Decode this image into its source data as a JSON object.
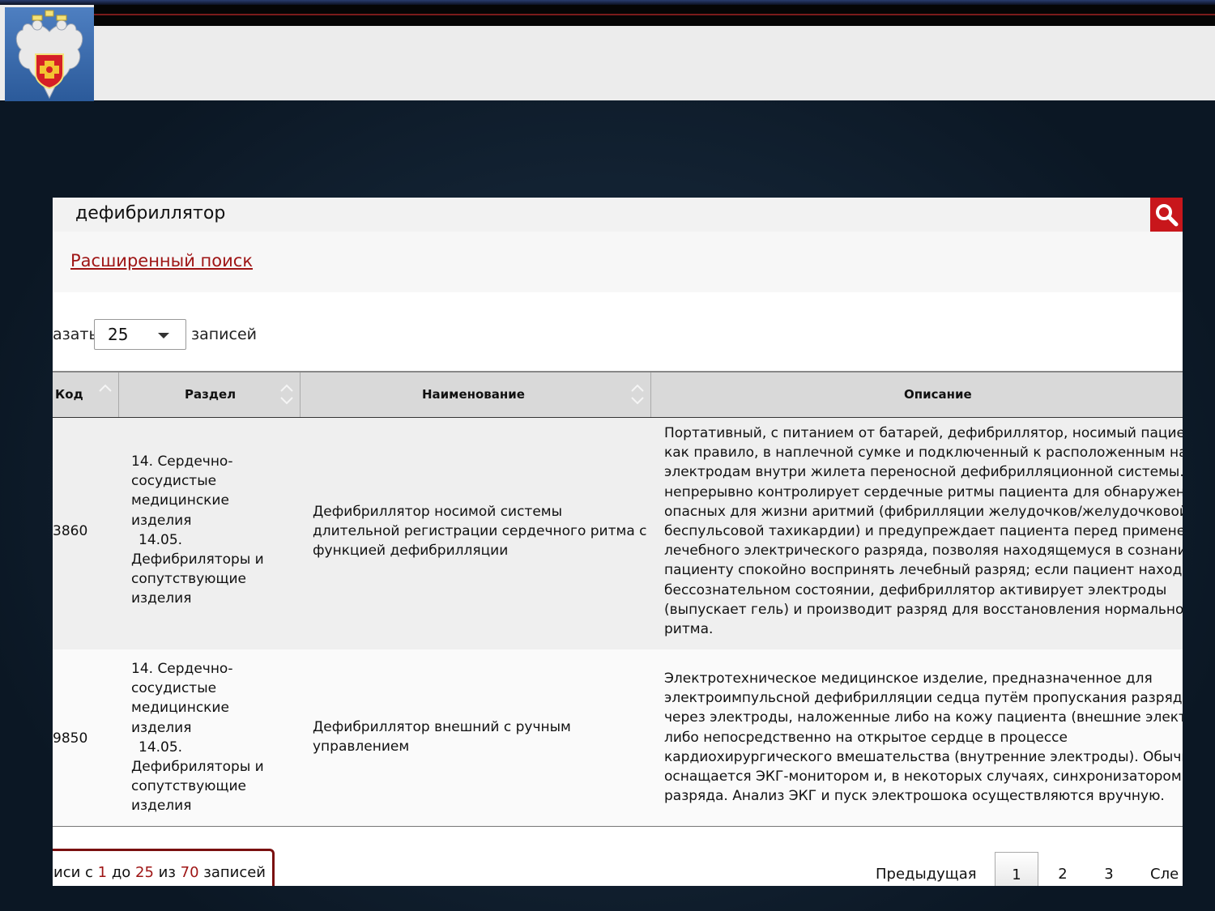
{
  "search": {
    "query": "дефибриллятор",
    "advanced_link": "Расширенный поиск"
  },
  "length": {
    "prefix": "азать",
    "value": "25",
    "suffix": "записей"
  },
  "table": {
    "headers": [
      "Код",
      "Раздел",
      "Наименование",
      "Описание"
    ],
    "rows": [
      {
        "code": "3860",
        "section": [
          "14. Сердечно-",
          "сосудистые",
          "медицинские",
          "изделия",
          "  14.05.",
          "Дефибриляторы и",
          "сопутствующие",
          "изделия"
        ],
        "name": [
          "Дефибриллятор носимой системы",
          "длительной регистрации сердечного ритма с",
          "функцией дефибрилляции"
        ],
        "description": [
          "Портативный, с питанием от батарей, дефибриллятор, носимый пациентом,",
          "как правило, в наплечной сумке и подключенный к расположенным на т",
          "электродам внутри жилета переносной дефибрилляционной системы. О",
          "непрерывно контролирует сердечные ритмы пациента для обнаружения",
          "опасных для жизни аритмий (фибрилляции желудочков/желудочковой",
          "беспульсовой тахикардии) и предупреждает пациента перед применени",
          "лечебного электрического разряда, позволяя находящемуся в сознании",
          "пациенту спокойно воспринять лечебный разряд; если пациент находит",
          "бессознательном состоянии, дефибриллятор активирует электроды",
          "(выпускает гель) и производит разряд для восстановления нормального",
          "ритма."
        ]
      },
      {
        "code": "9850",
        "section": [
          "14. Сердечно-",
          "сосудистые",
          "медицинские",
          "изделия",
          "  14.05.",
          "Дефибриляторы и",
          "сопутствующие",
          "изделия"
        ],
        "name": [
          "Дефибриллятор внешний с ручным",
          "управлением"
        ],
        "description": [
          "Электротехническое медицинское изделие, предназначенное для",
          "электроимпульсной дефибрилляции седца путём пропускания разряда",
          "через электроды, наложенные либо на кожу пациента (внешние электро",
          "либо непосредственно на открытое сердце в процессе",
          "кардиохирургического вмешательства (внутренние электроды). Обычно",
          "оснащается ЭКГ-монитором и, в некоторых случаях, синхронизатором",
          "разряда. Анализ ЭКГ и пуск электрошока осуществляются вручную."
        ]
      }
    ]
  },
  "info": {
    "prefix": "иси с ",
    "from": "1",
    "mid1": " до ",
    "to": "25",
    "mid2": " из ",
    "total": "70",
    "suffix": " записей"
  },
  "pagination": {
    "previous": "Предыдущая",
    "pages": [
      "1",
      "2",
      "3"
    ],
    "next": "Сле"
  },
  "colors": {
    "accent": "#c8161b",
    "link": "#9e1414"
  },
  "icons": {
    "search": "search-icon",
    "sort": "sort-arrows-icon",
    "dropdown": "chevron-down-icon",
    "emblem": "emblem-icon"
  }
}
